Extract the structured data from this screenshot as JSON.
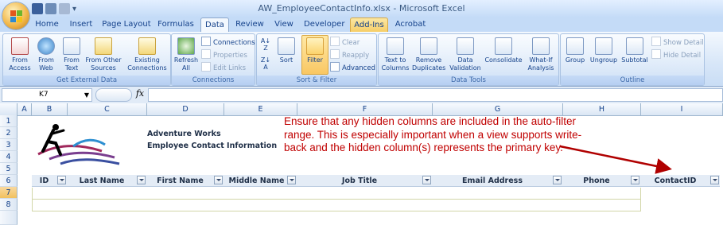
{
  "window": {
    "title": "AW_EmployeeContactInfo.xlsx - Microsoft Excel"
  },
  "tabs": [
    "Home",
    "Insert",
    "Page Layout",
    "Formulas",
    "Data",
    "Review",
    "View",
    "Developer",
    "Add-Ins",
    "Acrobat"
  ],
  "active_tab": "Data",
  "ribbon": {
    "get_external_data": {
      "label": "Get External Data",
      "from_access": "From Access",
      "from_web": "From Web",
      "from_text": "From Text",
      "from_other_sources": "From Other Sources",
      "existing_connections": "Existing Connections"
    },
    "connections": {
      "label": "Connections",
      "refresh_all": "Refresh All",
      "connections": "Connections",
      "properties": "Properties",
      "edit_links": "Edit Links"
    },
    "sort_filter": {
      "label": "Sort & Filter",
      "sort": "Sort",
      "filter": "Filter",
      "clear": "Clear",
      "reapply": "Reapply",
      "advanced": "Advanced"
    },
    "data_tools": {
      "label": "Data Tools",
      "text_to_columns": "Text to Columns",
      "remove_duplicates": "Remove Duplicates",
      "data_validation": "Data Validation",
      "consolidate": "Consolidate",
      "what_if": "What-If Analysis"
    },
    "outline": {
      "label": "Outline",
      "group": "Group",
      "ungroup": "Ungroup",
      "subtotal": "Subtotal",
      "show_detail": "Show Detail",
      "hide_detail": "Hide Detail"
    }
  },
  "formula_bar": {
    "name_box": "K7",
    "fx": "fx",
    "formula": ""
  },
  "columns": [
    "A",
    "B",
    "C",
    "D",
    "E",
    "F",
    "G",
    "H",
    "I"
  ],
  "rows": [
    "1",
    "2",
    "3",
    "4",
    "5",
    "6",
    "7",
    "8"
  ],
  "sheet": {
    "company_line1": "Adventure Works",
    "company_line2": "Employee Contact Information",
    "table_headers": [
      "ID",
      "Last Name",
      "First Name",
      "Middle Name",
      "Job Title",
      "Email Address",
      "Phone",
      "ContactID"
    ]
  },
  "annotation": "Ensure that any hidden columns are included in the auto-filter range.  This is especially important when a view supports write-back and the hidden column(s) represents the primary key.",
  "colors": {
    "annotation": "#c00000",
    "arrow": "#b00000",
    "accent": "#15428b"
  }
}
